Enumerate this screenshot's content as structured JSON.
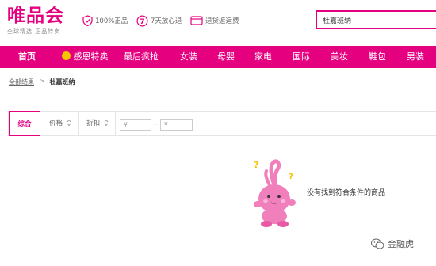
{
  "header": {
    "logo": "唯品会",
    "slogan": "全球精选  正品特卖",
    "promises": [
      {
        "icon": "shield-check-icon",
        "label": "100%正品"
      },
      {
        "icon": "seven-day-return-icon",
        "label": "7天放心退"
      },
      {
        "icon": "return-shipping-icon",
        "label": "退货返运费"
      }
    ],
    "search_value": "杜嘉班纳"
  },
  "nav": {
    "items": [
      "首页",
      "感恩特卖",
      "最后疯抢",
      "女装",
      "母婴",
      "家电",
      "国际",
      "美妆",
      "鞋包",
      "男装"
    ],
    "active_index": 0
  },
  "breadcrumb": {
    "root": "全部结果",
    "separator": ">",
    "current": "杜嘉班纳"
  },
  "sortbar": {
    "default_label": "综合",
    "price_label": "价格",
    "discount_label": "折扣",
    "price_min_placeholder": "¥",
    "price_max_placeholder": "¥",
    "range_separator": "-"
  },
  "empty": {
    "message": "没有找到符合条件的商品"
  },
  "watermark": {
    "label": "金融虎",
    "icon": "wechat-icon"
  },
  "colors": {
    "brand": "#e4007f",
    "mascot": "#f07fbc",
    "question_mark": "#f5c400"
  }
}
